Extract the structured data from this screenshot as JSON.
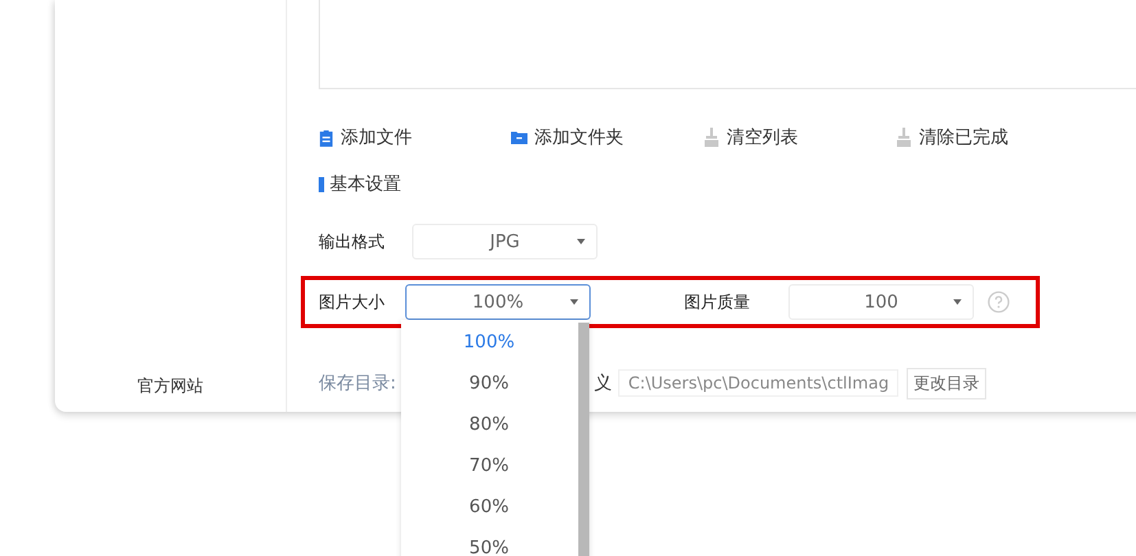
{
  "sidebar": {
    "link": "官方网站"
  },
  "toolbar": [
    {
      "kind": "file",
      "label": "添加文件"
    },
    {
      "kind": "folder",
      "label": "添加文件夹"
    },
    {
      "kind": "clear",
      "label": "清空列表"
    },
    {
      "kind": "clear",
      "label": "清除已完成"
    }
  ],
  "section_title": "基本设置",
  "output_format": {
    "label": "输出格式",
    "value": "JPG"
  },
  "image_size": {
    "label": "图片大小",
    "value": "100%",
    "expanded": true
  },
  "image_quality": {
    "label": "图片质量",
    "value": "100"
  },
  "save_dir": {
    "label": "保存目录:",
    "fragment": "义",
    "path": "C:\\Users\\pc\\Documents\\ctlImag",
    "button": "更改目录"
  },
  "size_options": [
    {
      "label": "100%",
      "selected": true
    },
    {
      "label": "90%",
      "selected": false
    },
    {
      "label": "80%",
      "selected": false
    },
    {
      "label": "70%",
      "selected": false
    },
    {
      "label": "60%",
      "selected": false
    },
    {
      "label": "50%",
      "selected": false
    }
  ]
}
